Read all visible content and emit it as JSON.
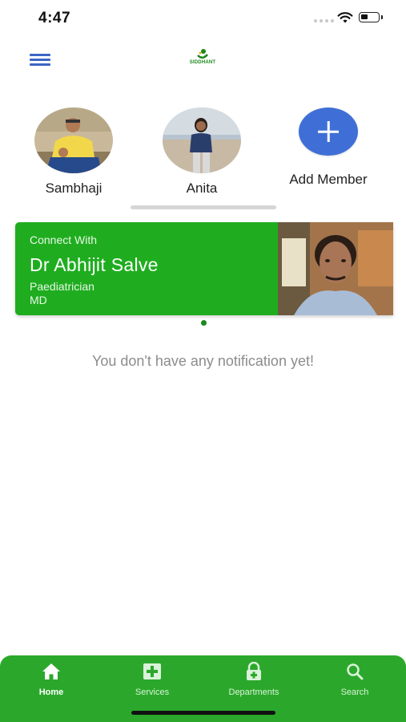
{
  "status_bar": {
    "time": "4:47"
  },
  "header": {
    "logo_text": "SIDDHANT",
    "logo_sub": "",
    "menu_icon": "hamburger-icon"
  },
  "members": [
    {
      "name": "Sambhaji"
    },
    {
      "name": "Anita"
    }
  ],
  "add_member": {
    "label": "Add Member",
    "icon": "plus-icon"
  },
  "connect_card": {
    "heading": "Connect With",
    "doctor_name": "Dr Abhijit Salve",
    "specialty": "Paediatrician",
    "degree": "MD"
  },
  "notifications": {
    "empty_message": "You don't have any notification yet!"
  },
  "tabs": [
    {
      "label": "Home",
      "icon": "home-icon",
      "active": true
    },
    {
      "label": "Services",
      "icon": "medical-plus-icon",
      "active": false
    },
    {
      "label": "Departments",
      "icon": "lock-icon",
      "active": false
    },
    {
      "label": "Search",
      "icon": "search-icon",
      "active": false
    }
  ],
  "colors": {
    "primary_green": "#2ba82b",
    "card_green": "#1fad1f",
    "accent_blue": "#3f6fd6",
    "muted_text": "#8c8c8c"
  }
}
